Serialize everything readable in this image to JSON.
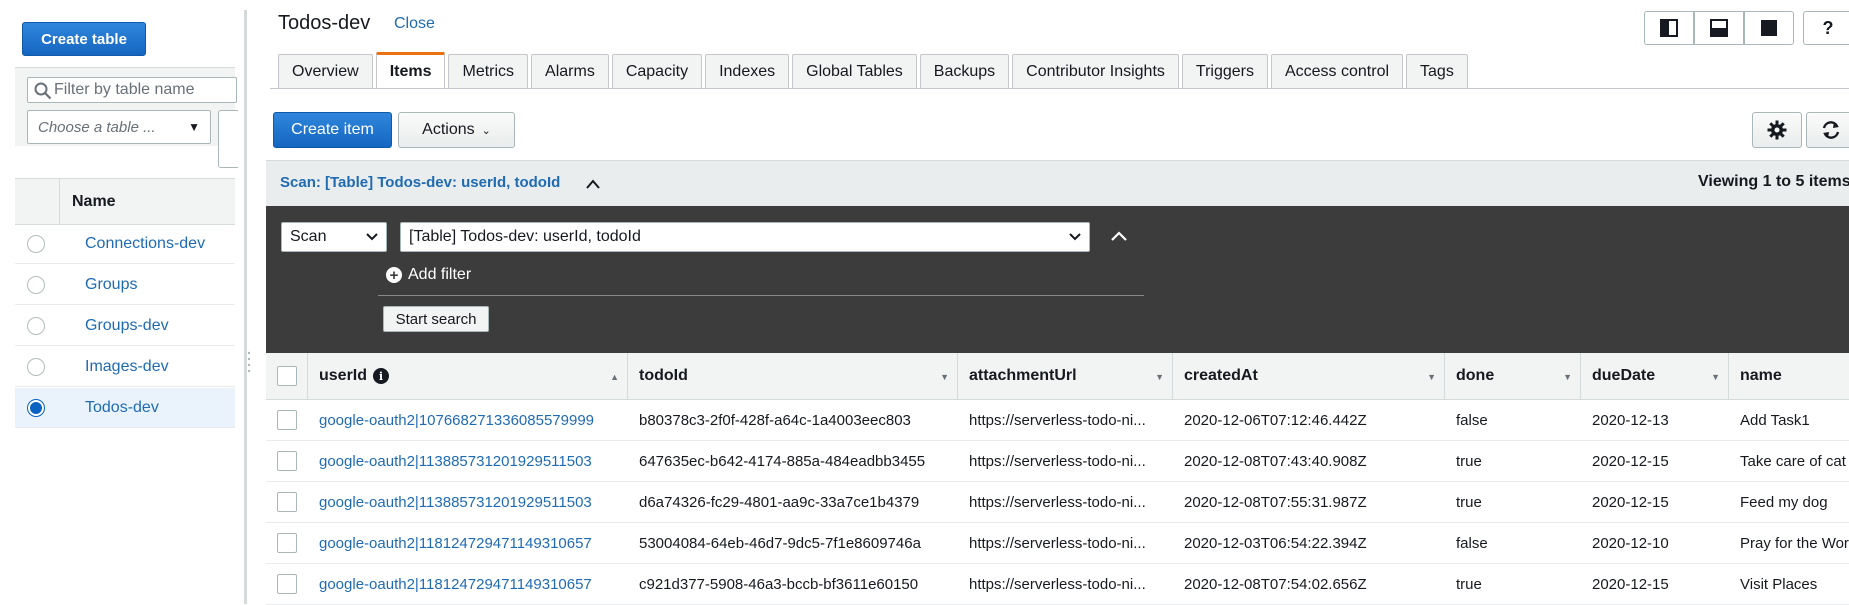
{
  "sidebar": {
    "create_table_label": "Create table",
    "filter_placeholder": "Filter by table name",
    "choose_table_placeholder": "Choose a table ...",
    "name_header": "Name",
    "tables": [
      {
        "label": "Connections-dev",
        "selected": false
      },
      {
        "label": "Groups",
        "selected": false
      },
      {
        "label": "Groups-dev",
        "selected": false
      },
      {
        "label": "Images-dev",
        "selected": false
      },
      {
        "label": "Todos-dev",
        "selected": true
      }
    ]
  },
  "header": {
    "title": "Todos-dev",
    "close_label": "Close",
    "help_label": "?"
  },
  "tabs": [
    {
      "label": "Overview",
      "active": false
    },
    {
      "label": "Items",
      "active": true
    },
    {
      "label": "Metrics",
      "active": false
    },
    {
      "label": "Alarms",
      "active": false
    },
    {
      "label": "Capacity",
      "active": false
    },
    {
      "label": "Indexes",
      "active": false
    },
    {
      "label": "Global Tables",
      "active": false
    },
    {
      "label": "Backups",
      "active": false
    },
    {
      "label": "Contributor Insights",
      "active": false
    },
    {
      "label": "Triggers",
      "active": false
    },
    {
      "label": "Access control",
      "active": false
    },
    {
      "label": "Tags",
      "active": false
    }
  ],
  "toolbar": {
    "create_item_label": "Create item",
    "actions_label": "Actions"
  },
  "scan": {
    "summary": "Scan: [Table] Todos-dev: userId, todoId",
    "viewing": "Viewing 1 to 5 items",
    "mode_value": "Scan",
    "target_value": "[Table] Todos-dev: userId, todoId",
    "add_filter_label": "Add filter",
    "start_search_label": "Start search"
  },
  "items_table": {
    "columns": [
      "userId",
      "todoId",
      "attachmentUrl",
      "createdAt",
      "done",
      "dueDate",
      "name"
    ],
    "rows": [
      [
        "google-oauth2|107668271336085579999",
        "b80378c3-2f0f-428f-a64c-1a4003eec803",
        "https://serverless-todo-ni...",
        "2020-12-06T07:12:46.442Z",
        "false",
        "2020-12-13",
        "Add Task1"
      ],
      [
        "google-oauth2|113885731201929511503",
        "647635ec-b642-4174-885a-484eadbb3455",
        "https://serverless-todo-ni...",
        "2020-12-08T07:43:40.908Z",
        "true",
        "2020-12-15",
        "Take care of cat"
      ],
      [
        "google-oauth2|113885731201929511503",
        "d6a74326-fc29-4801-aa9c-33a7ce1b4379",
        "https://serverless-todo-ni...",
        "2020-12-08T07:55:31.987Z",
        "true",
        "2020-12-15",
        "Feed my dog"
      ],
      [
        "google-oauth2|118124729471149310657",
        "53004084-64eb-46d7-9dc5-7f1e8609746a",
        "https://serverless-todo-ni...",
        "2020-12-03T06:54:22.394Z",
        "false",
        "2020-12-10",
        "Pray for the Wor"
      ],
      [
        "google-oauth2|118124729471149310657",
        "c921d377-5908-46a3-bccb-bf3611e60150",
        "https://serverless-todo-ni...",
        "2020-12-08T07:54:02.656Z",
        "true",
        "2020-12-15",
        "Visit Places"
      ]
    ]
  },
  "colors": {
    "primary": "#1f6bb3",
    "active_tab_accent": "#ec7211",
    "dark_panel": "#3c3c3c"
  }
}
